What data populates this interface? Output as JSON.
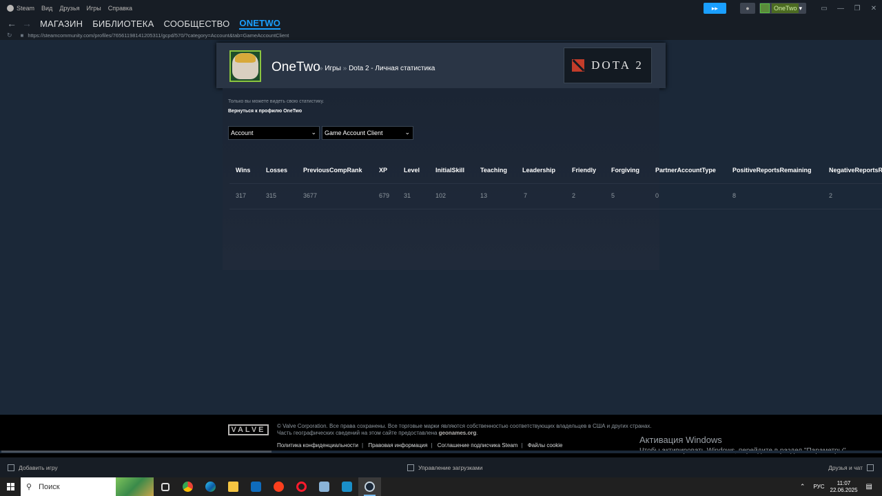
{
  "titlebar": {
    "app_name": "Steam",
    "menu": [
      "Вид",
      "Друзья",
      "Игры",
      "Справка"
    ],
    "username": "OneTwo"
  },
  "nav": {
    "links": [
      "МАГАЗИН",
      "БИБЛИОТЕКА",
      "СООБЩЕСТВО",
      "ONETWO"
    ],
    "active": "ONETWO"
  },
  "url": "https://steamcommunity.com/profiles/76561198141205311/gcpd/570/?category=Account&tab=GameAccountClient",
  "profile": {
    "name": "OneTwo",
    "crumb_games": "Игры",
    "crumb_stats": "Dota 2 - Личная статистика",
    "game_logo_text": "DOTA 2"
  },
  "notice": "Только вы можете видеть свою статистику.",
  "back_link": "Вернуться к профилю OneTwo",
  "category_select": "Account",
  "tab_select": "Game Account Client",
  "table": {
    "headers": [
      "Wins",
      "Losses",
      "PreviousCompRank",
      "XP",
      "Level",
      "InitialSkill",
      "Teaching",
      "Leadership",
      "Friendly",
      "Forgiving",
      "PartnerAccountType",
      "PositiveReportsRemaining",
      "NegativeReportsRemaining"
    ],
    "row": [
      "317",
      "315",
      "3677",
      "679",
      "31",
      "102",
      "13",
      "7",
      "2",
      "5",
      "0",
      "8",
      "2"
    ]
  },
  "footer": {
    "valve_logo": "VALVE",
    "copyright_line1": "© Valve Corporation. Все права сохранены. Все торговые марки являются собственностью соответствующих владельцев в США и других странах.",
    "copyright_line2_prefix": "Часть географических сведений на этом сайте предоставлена",
    "copyright_line2_link": "geonames.org",
    "links": [
      "Политика конфиденциальности",
      "Правовая информация",
      "Соглашение подписчика Steam",
      "Файлы cookie"
    ]
  },
  "activation": {
    "title": "Активация Windows",
    "subtitle": "Чтобы активировать Windows, перейдите в раздел \"Параметры\"."
  },
  "steambar": {
    "add_game": "Добавить игру",
    "downloads": "Управление загрузками",
    "friends": "Друзья и чат"
  },
  "taskbar": {
    "search_placeholder": "Поиск",
    "lang": "РУС",
    "time": "11:07",
    "date": "22.06.2025"
  },
  "colors": {
    "accent": "#1a9fff",
    "background": "#1b2838"
  }
}
